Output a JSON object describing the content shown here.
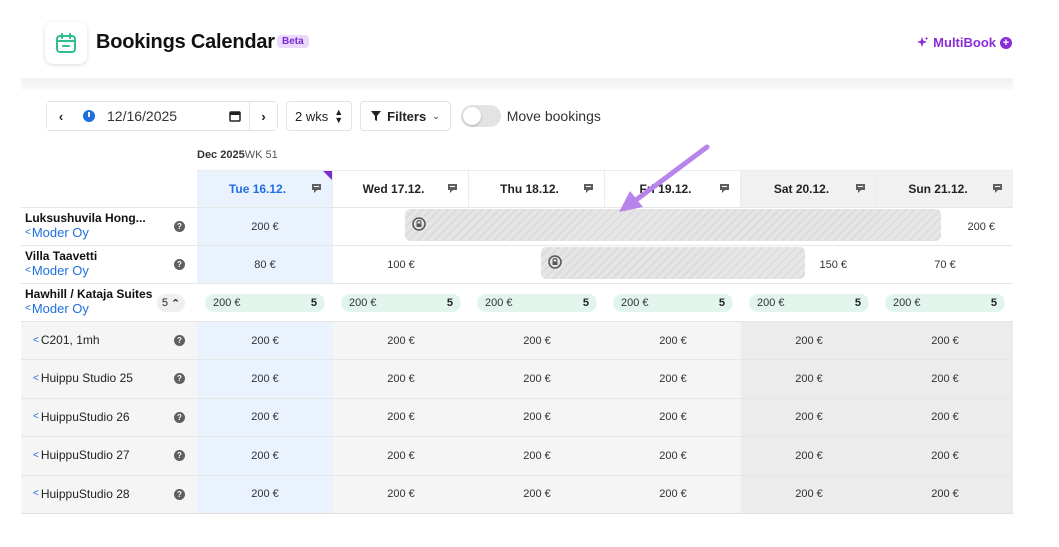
{
  "header": {
    "title": "Bookings Calendar",
    "badge": "Beta",
    "multibook_label": "MultiBook",
    "accent": "#8a2cd8",
    "logo_icon": "calendar-icon"
  },
  "toolbar": {
    "date_value": "12/16/2025",
    "span_value": "2 wks",
    "filters_label": "Filters",
    "toggle_label": "Move bookings",
    "toggle_on": false
  },
  "calendar": {
    "month_label": "Dec 2025",
    "week_label": "WK 51",
    "days": [
      {
        "label": "Tue 16.12.",
        "today": true
      },
      {
        "label": "Wed 17.12.",
        "today": false
      },
      {
        "label": "Thu 18.12.",
        "today": false
      },
      {
        "label": "Fri 19.12.",
        "today": false
      },
      {
        "label": "Sat 20.12.",
        "today": false
      },
      {
        "label": "Sun 21.12.",
        "today": false
      }
    ],
    "properties": [
      {
        "name": "Luksushuvila Hong...",
        "owner": "Moder Oy",
        "prices": [
          "200 €",
          "",
          "",
          "",
          "",
          "200 €"
        ]
      },
      {
        "name": "Villa Taavetti",
        "owner": "Moder Oy",
        "prices": [
          "80 €",
          "100 €",
          "",
          "",
          "150 €",
          "70 €"
        ]
      }
    ],
    "group": {
      "name": "Hawhill / Kataja Suites",
      "owner": "Moder Oy",
      "count": "5",
      "pills": [
        {
          "price": "200 €",
          "avail": "5"
        },
        {
          "price": "200 €",
          "avail": "5"
        },
        {
          "price": "200 €",
          "avail": "5"
        },
        {
          "price": "200 €",
          "avail": "5"
        },
        {
          "price": "200 €",
          "avail": "5"
        },
        {
          "price": "200 €",
          "avail": "5"
        }
      ]
    },
    "units": [
      {
        "name": "C201, 1mh",
        "prices": [
          "200 €",
          "200 €",
          "200 €",
          "200 €",
          "200 €",
          "200 €"
        ]
      },
      {
        "name": "Huippu Studio 25",
        "prices": [
          "200 €",
          "200 €",
          "200 €",
          "200 €",
          "200 €",
          "200 €"
        ]
      },
      {
        "name": "HuippuStudio 26",
        "prices": [
          "200 €",
          "200 €",
          "200 €",
          "200 €",
          "200 €",
          "200 €"
        ]
      },
      {
        "name": "HuippuStudio 27",
        "prices": [
          "200 €",
          "200 €",
          "200 €",
          "200 €",
          "200 €",
          "200 €"
        ]
      },
      {
        "name": "HuippuStudio 28",
        "prices": [
          "200 €",
          "200 €",
          "200 €",
          "200 €",
          "200 €",
          "200 €"
        ]
      }
    ]
  },
  "colors": {
    "today_column": "#eaf2fe",
    "weekday_unit_bg": "#f5f5f5",
    "weekend_bg": "#ececec",
    "pill_bg": "#e1f5ed",
    "owner_link": "#1f6fe0",
    "annotation_arrow": "#b784ea"
  }
}
